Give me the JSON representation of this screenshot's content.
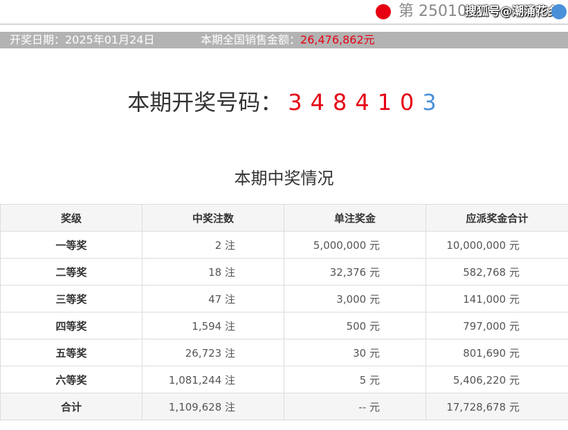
{
  "header": {
    "issue_text": "第 25010",
    "watermark": "搜狐号@潮涌花乡"
  },
  "info": {
    "date_label": "开奖日期：2025年01月24日",
    "sales_label": "本期全国销售金额：",
    "sales_amount": "26,476,862元"
  },
  "draw": {
    "title": "本期开奖号码：",
    "red_numbers": [
      "3",
      "4",
      "8",
      "4",
      "1",
      "0"
    ],
    "blue_number": "3"
  },
  "section": {
    "title": "本期中奖情况"
  },
  "table": {
    "headers": [
      "奖级",
      "中奖注数",
      "单注奖金",
      "应派奖金合计"
    ],
    "rows": [
      {
        "level": "一等奖",
        "count": "2 注",
        "unit": "5,000,000 元",
        "total": "10,000,000 元"
      },
      {
        "level": "二等奖",
        "count": "18 注",
        "unit": "32,376 元",
        "total": "582,768 元"
      },
      {
        "level": "三等奖",
        "count": "47 注",
        "unit": "3,000 元",
        "total": "141,000 元"
      },
      {
        "level": "四等奖",
        "count": "1,594 注",
        "unit": "500 元",
        "total": "797,000 元"
      },
      {
        "level": "五等奖",
        "count": "26,723 注",
        "unit": "30 元",
        "total": "801,690 元"
      },
      {
        "level": "六等奖",
        "count": "1,081,244 注",
        "unit": "5 元",
        "total": "5,406,220 元"
      },
      {
        "level": "合计",
        "count": "1,109,628 注",
        "unit": "-- 元",
        "total": "17,728,678 元"
      }
    ]
  },
  "colors": {
    "red": "#e60012",
    "blue": "#4a90d9",
    "grey_bar": "#b3b3b3"
  }
}
